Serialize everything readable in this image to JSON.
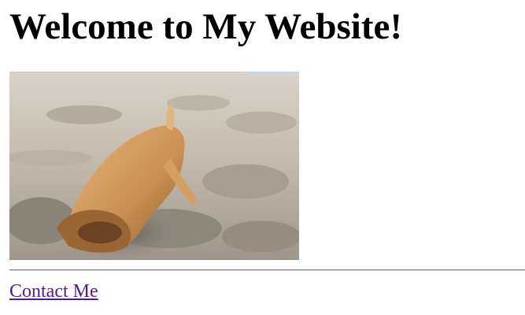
{
  "page": {
    "title": "Welcome to My Website!",
    "image_subject": "puppy digging in sand",
    "contact_link": "Contact Me",
    "colors": {
      "background": "#ffffff",
      "text": "#000000",
      "visited_link": "#551a8b",
      "rule": "#7a7a7a"
    }
  }
}
